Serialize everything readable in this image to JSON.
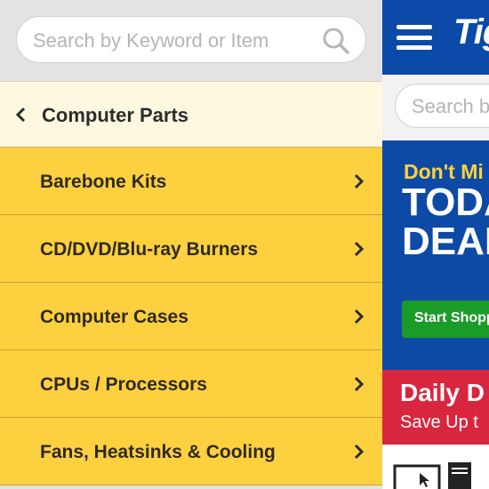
{
  "drawer": {
    "search": {
      "placeholder": "Search by Keyword or Item",
      "icon": "search-icon"
    },
    "back": {
      "icon": "chevron-left-icon",
      "title": "Computer Parts"
    },
    "items": [
      {
        "label": "Barebone Kits",
        "icon": "chevron-right-icon"
      },
      {
        "label": "CD/DVD/Blu-ray Burners",
        "icon": "chevron-right-icon"
      },
      {
        "label": "Computer Cases",
        "icon": "chevron-right-icon"
      },
      {
        "label": "CPUs / Processors",
        "icon": "chevron-right-icon"
      },
      {
        "label": "Fans, Heatsinks & Cooling",
        "icon": "chevron-right-icon"
      }
    ]
  },
  "page": {
    "logo": "Tig",
    "search": {
      "placeholder": "Search b"
    },
    "banner": {
      "tagline": "Don't Mi",
      "headline1": "TODA",
      "headline2": "DEAL",
      "cta": "Start Shopp"
    },
    "daily": {
      "title": "Daily D",
      "subtitle": "Save Up t"
    }
  },
  "colors": {
    "menu_yellow": "#fdd040",
    "back_row": "#fef8e1",
    "brand_blue": "#0b4aa8",
    "cta_green": "#1a9c28",
    "daily_red": "#d9263f"
  }
}
